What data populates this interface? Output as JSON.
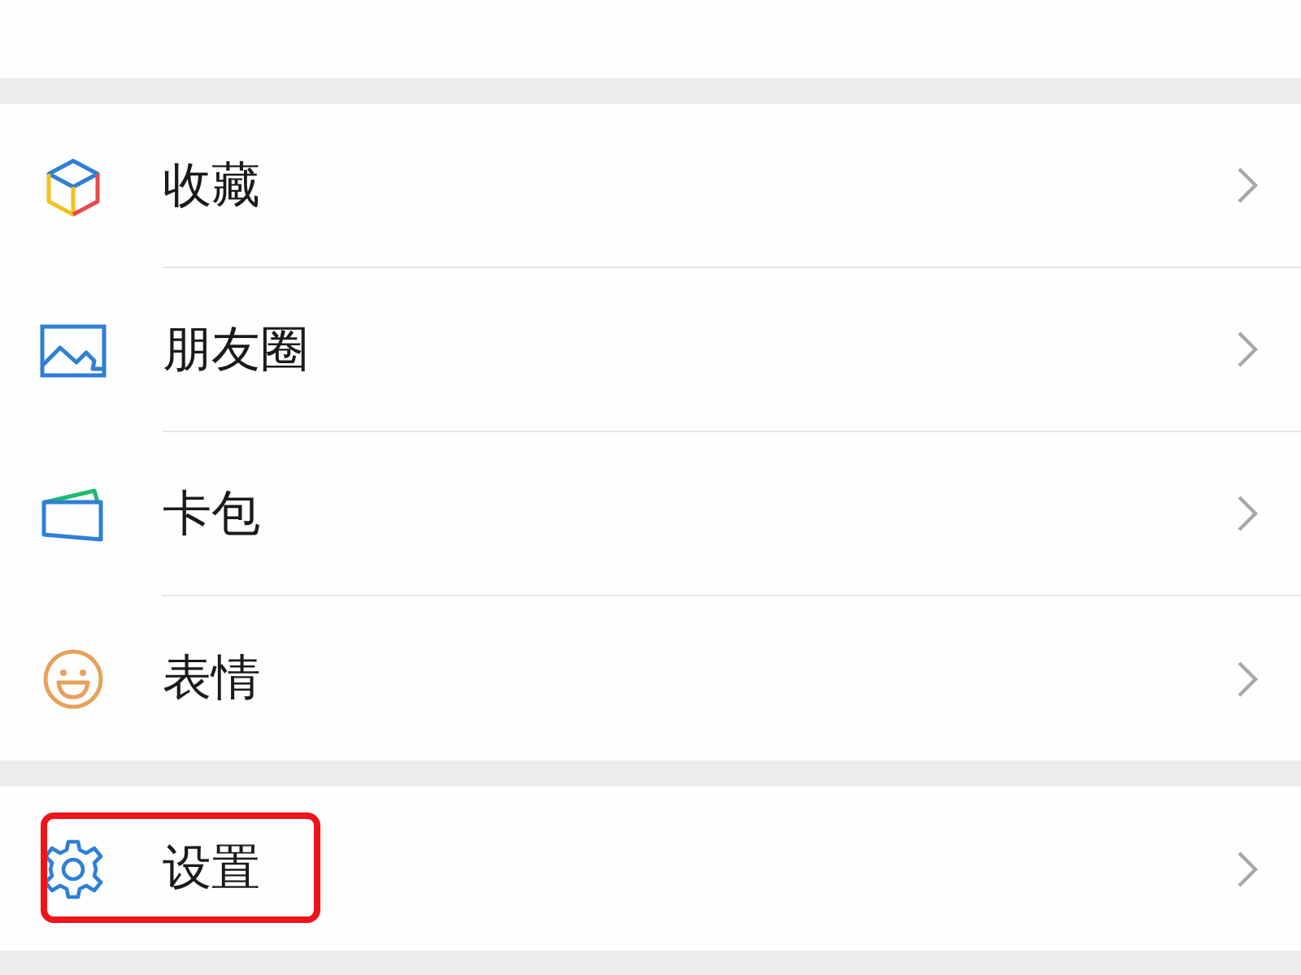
{
  "groups": [
    {
      "items": [
        {
          "kind": "cube",
          "label": "收藏",
          "highlighted": false
        },
        {
          "kind": "picture",
          "label": "朋友圈",
          "highlighted": false
        },
        {
          "kind": "card",
          "label": "卡包",
          "highlighted": false
        },
        {
          "kind": "smile",
          "label": "表情",
          "highlighted": false
        }
      ]
    },
    {
      "items": [
        {
          "kind": "gear",
          "label": "设置",
          "highlighted": true
        }
      ]
    }
  ]
}
